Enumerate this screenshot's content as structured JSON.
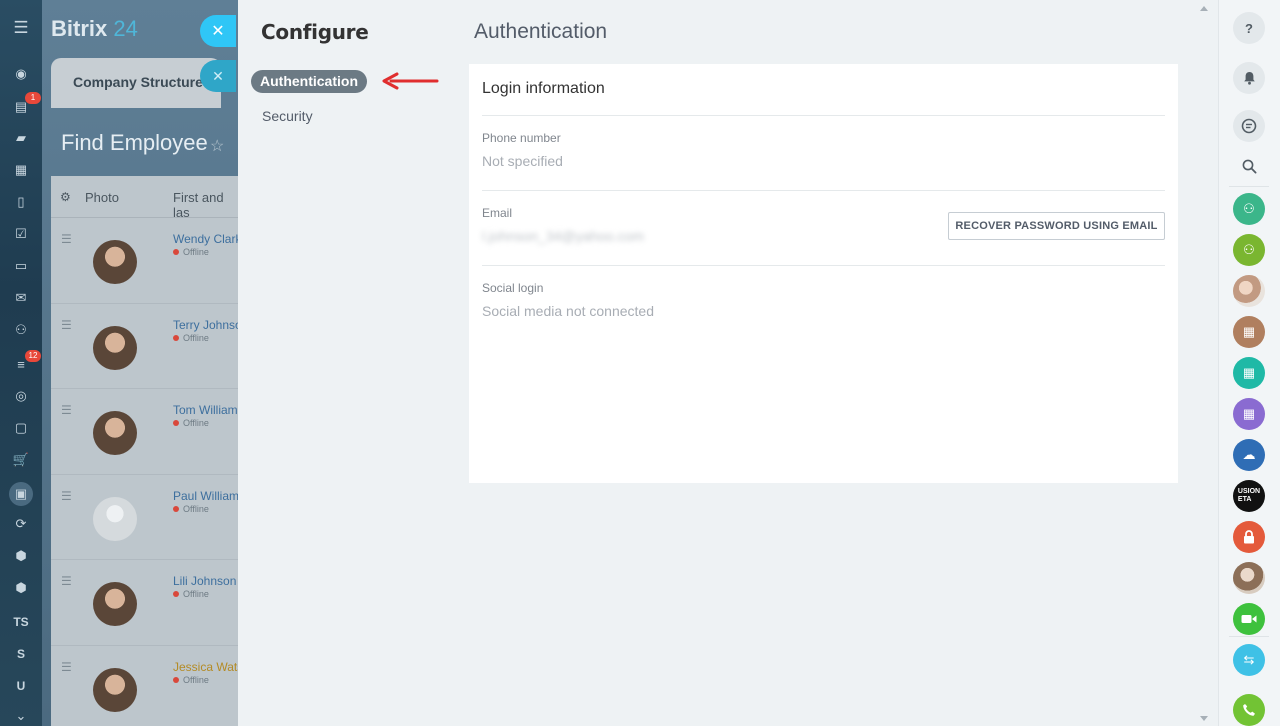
{
  "portal": {
    "logo_name": "Bitrix",
    "logo_number": "24",
    "bg_tab": "Company Structure",
    "bg_heading": "Find Employee",
    "table_headers": {
      "photo": "Photo",
      "name": "First and las"
    },
    "rows": [
      {
        "name": "Wendy Clark",
        "status": "Offline",
        "highlight": false
      },
      {
        "name": "Terry Johnso",
        "status": "Offline",
        "highlight": false
      },
      {
        "name": "Tom Williams",
        "status": "Offline",
        "highlight": false
      },
      {
        "name": "Paul William",
        "status": "Offline",
        "highlight": false,
        "no_photo": true
      },
      {
        "name": "Lili Johnson",
        "status": "Offline",
        "highlight": false
      },
      {
        "name": "Jessica Wats",
        "status": "Offline",
        "highlight": true
      }
    ]
  },
  "left_rail": {
    "badges": {
      "feed": "1",
      "sales": "12"
    },
    "text_items": [
      "TS",
      "S",
      "U"
    ]
  },
  "panel": {
    "config_title": "Configure",
    "menu": {
      "active": "Authentication",
      "second": "Security"
    },
    "page_title": "Authentication",
    "card": {
      "title": "Login information",
      "phone_label": "Phone number",
      "phone_value": "Not specified",
      "email_label": "Email",
      "email_value": "l.johnson_34@yahoo.com",
      "recover_button": "RECOVER PASSWORD USING EMAIL",
      "social_label": "Social login",
      "social_value": "Social media not connected"
    }
  },
  "colors": {
    "accent_blue": "#2fc6f6",
    "active_pill": "#6c7a84",
    "arrow_red": "#e02e2e",
    "badge_red": "#e8483a"
  },
  "right_rail": {
    "items": [
      {
        "icon": "help-icon",
        "glyph": "?"
      },
      {
        "icon": "bell-icon",
        "glyph": "🔔"
      },
      {
        "icon": "chat-icon",
        "glyph": "☰"
      },
      {
        "icon": "search-icon",
        "glyph": "⌕"
      },
      {
        "icon": "group-icon",
        "color": "#3bb68a"
      },
      {
        "icon": "group-icon",
        "color": "#7ab630"
      },
      {
        "icon": "people-avatar-icon",
        "color": "#c9b8a8"
      },
      {
        "icon": "calendar-icon",
        "color": "#b07f5f"
      },
      {
        "icon": "calendar-icon",
        "color": "#1fb9a6"
      },
      {
        "icon": "calendar-icon",
        "color": "#8a6bd1"
      },
      {
        "icon": "team-chat-icon",
        "color": "#2f6db5"
      },
      {
        "icon": "fusion-logo-icon",
        "color": "#111111",
        "label": "USION\nETA"
      },
      {
        "icon": "lock-icon",
        "color": "#e45a3b"
      },
      {
        "icon": "user-avatar-icon",
        "color": "#c9b39a"
      },
      {
        "icon": "video-icon",
        "color": "#3ec13d"
      },
      {
        "icon": "phone-transfer-icon",
        "color": "#3fc1e6"
      },
      {
        "icon": "phone-icon",
        "color": "#72c334"
      }
    ]
  }
}
